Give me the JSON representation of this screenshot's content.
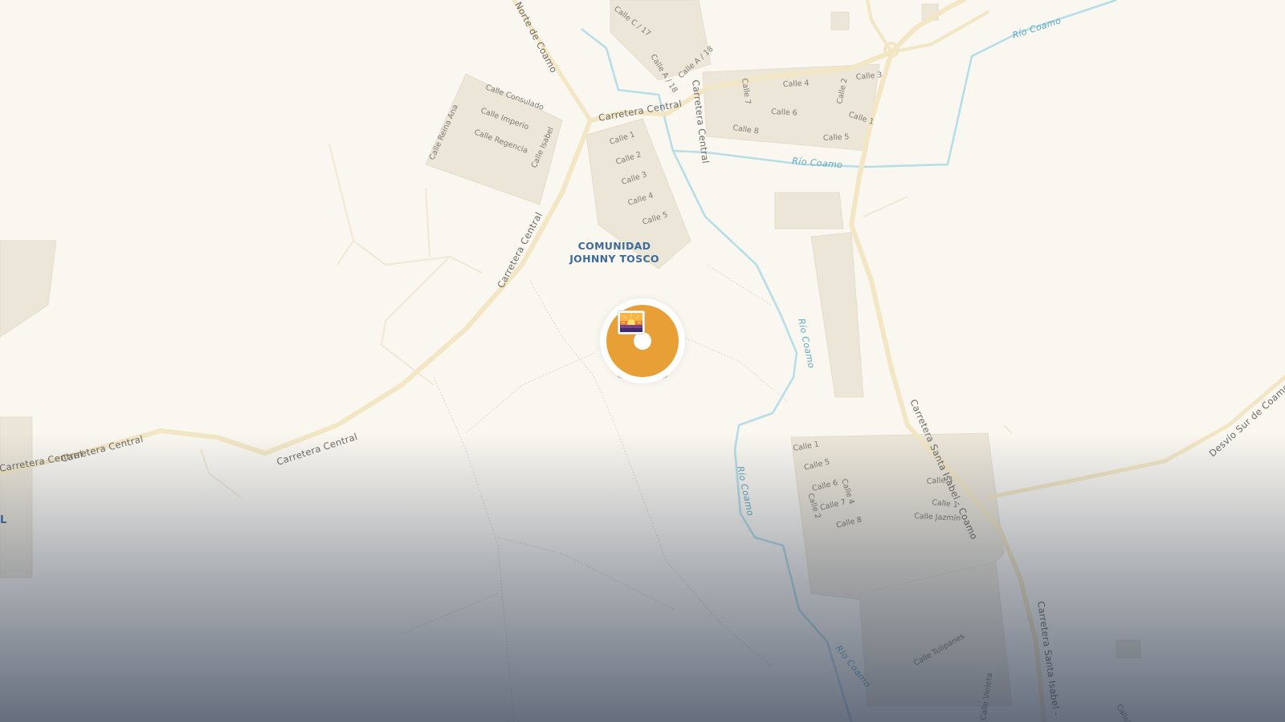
{
  "map": {
    "place_label": [
      "COMUNIDAD",
      "JOHNNY TOSCO"
    ],
    "partial_label_left": "L",
    "roads": [
      "Carretera Central",
      "Carretera Central",
      "Carretera Central",
      "Carretera Central",
      "Carretera Central",
      "Carretera Central",
      "Carretera Central",
      "Norte de Coamo",
      "Carretera Santa Isabel - Coamo",
      "Carretera Santa Isabel -",
      "Desvío Sur de Coamo"
    ],
    "rivers": [
      "Río Coamo",
      "Río Coamo",
      "Río Coamo",
      "Río Coamo",
      "Río Coamo"
    ],
    "streets": [
      "Calle C / 17",
      "Calle A / 18",
      "Calle A / 18",
      "Calle Consulado",
      "Calle Imperio",
      "Calle Regencia",
      "Calle Reina Ana",
      "Calle Isabel",
      "Calle 1",
      "Calle 2",
      "Calle 3",
      "Calle 4",
      "Calle 5",
      "Calle 4",
      "Calle 3",
      "Calle 7",
      "Calle 2",
      "Calle 6",
      "Calle 1",
      "Calle 8",
      "Calle 5",
      "Calle 1",
      "Calle 5",
      "Calle 6",
      "Calle 4",
      "Calle 2",
      "Calle 7",
      "Calle 8",
      "Calle 3",
      "Calle 1",
      "Calle Jazmín",
      "Calle Tulipanes",
      "Calle Violeta",
      "Callejón"
    ],
    "colors": {
      "land": "#faf7f0",
      "road": "#f3e6c4",
      "river": "#b7dde6",
      "block": "#ece6d8",
      "marker": "#e89f35",
      "place_label": "#3d6b9c"
    },
    "marker": {
      "type": "photo-marker",
      "icon": "sunset-photo-icon"
    }
  }
}
